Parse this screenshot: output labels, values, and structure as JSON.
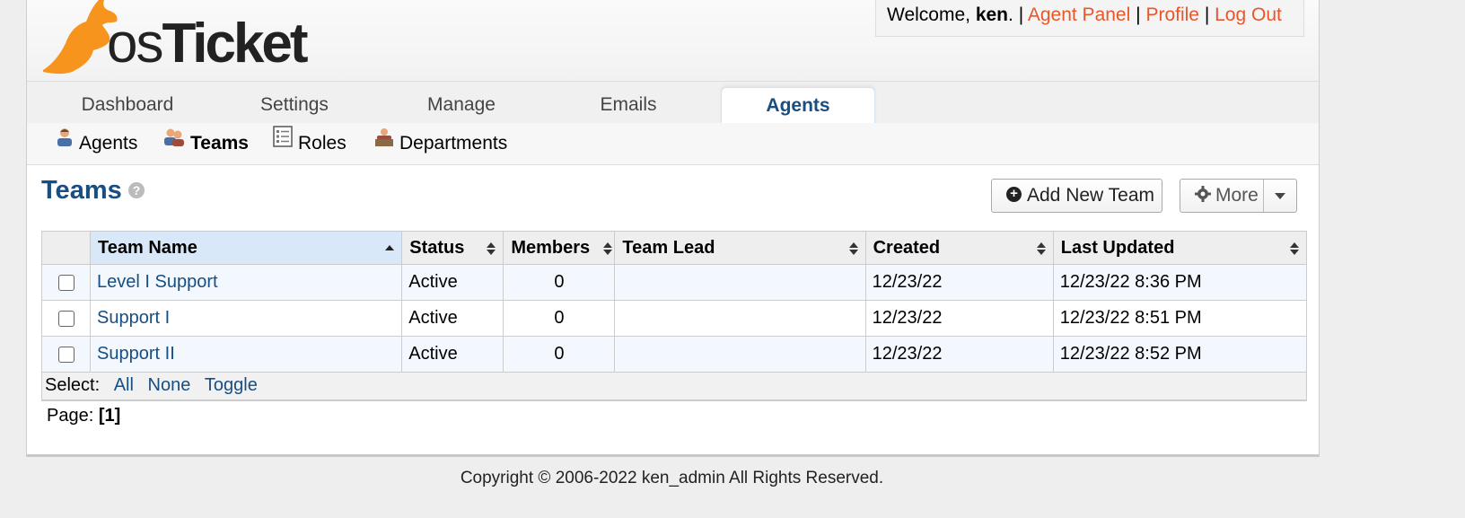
{
  "header": {
    "logo_text_os": "os",
    "logo_text_ticket": "Ticket",
    "welcome_prefix": "Welcome, ",
    "username": "ken",
    "welcome_suffix": ".",
    "separator": "|",
    "links": [
      "Agent Panel",
      "Profile",
      "Log Out"
    ]
  },
  "nav": {
    "tabs": [
      "Dashboard",
      "Settings",
      "Manage",
      "Emails",
      "Agents"
    ],
    "active": "Agents"
  },
  "subnav": {
    "items": [
      {
        "label": "Agents",
        "icon": "agent-icon"
      },
      {
        "label": "Teams",
        "icon": "teams-icon",
        "active": true
      },
      {
        "label": "Roles",
        "icon": "roles-icon"
      },
      {
        "label": "Departments",
        "icon": "departments-icon"
      }
    ]
  },
  "page": {
    "title": "Teams",
    "help": "?",
    "add_button": "Add New Team",
    "more_button": "More"
  },
  "table": {
    "columns": [
      "Team Name",
      "Status",
      "Members",
      "Team Lead",
      "Created",
      "Last Updated"
    ],
    "rows": [
      {
        "name": "Level I Support",
        "status": "Active",
        "members": "0",
        "lead": "",
        "created": "12/23/22",
        "updated": "12/23/22 8:36 PM"
      },
      {
        "name": "Support I",
        "status": "Active",
        "members": "0",
        "lead": "",
        "created": "12/23/22",
        "updated": "12/23/22 8:51 PM"
      },
      {
        "name": "Support II",
        "status": "Active",
        "members": "0",
        "lead": "",
        "created": "12/23/22",
        "updated": "12/23/22 8:52 PM"
      }
    ],
    "select_label": "Select:",
    "select_links": [
      "All",
      "None",
      "Toggle"
    ]
  },
  "pager": {
    "label": "Page:",
    "current": "[1]"
  },
  "footer": {
    "text": "Copyright © 2006-2022 ken_admin All Rights Reserved."
  },
  "colors": {
    "accent": "#184e81",
    "link_orange": "#e8562a",
    "logo_orange": "#f7941d"
  }
}
